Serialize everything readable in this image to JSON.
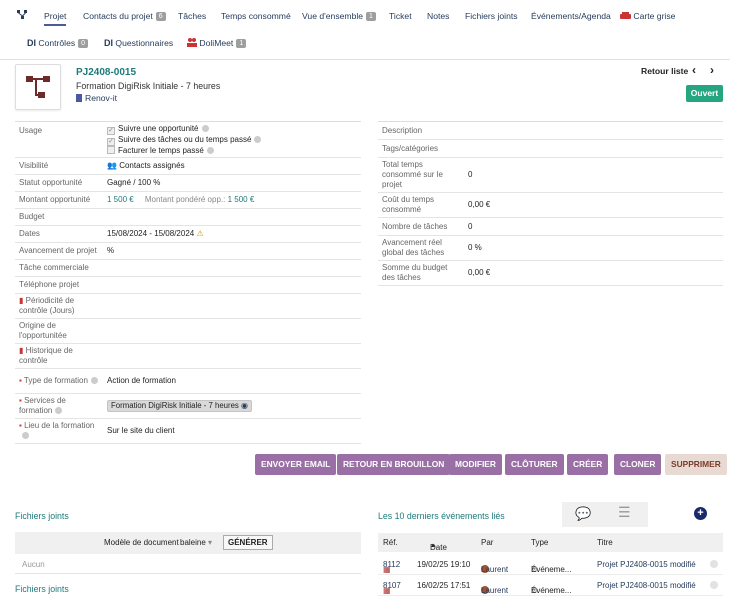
{
  "tabs": [
    {
      "label": "Projet"
    },
    {
      "label": "Contacts du projet",
      "badge": "6"
    },
    {
      "label": "Tâches"
    },
    {
      "label": "Temps consommé"
    },
    {
      "label": "Vue d'ensemble",
      "badge": "1"
    },
    {
      "label": "Ticket"
    },
    {
      "label": "Notes"
    },
    {
      "label": "Fichiers joints"
    },
    {
      "label": "Événements/Agenda"
    },
    {
      "label": "Carte grise"
    }
  ],
  "tabs2": [
    {
      "label": "Contrôles",
      "badge": "0",
      "prefix": "DI"
    },
    {
      "label": "Questionnaires",
      "prefix": "DI"
    },
    {
      "label": "DoliMeet",
      "badge": "1"
    }
  ],
  "header": {
    "ref": "PJ2408-0015",
    "title": "Formation DigiRisk Initiale - 7 heures",
    "thirdparty": "Renov-it",
    "back_link": "Retour liste",
    "status": "Ouvert"
  },
  "left_fields": {
    "usage_label": "Usage",
    "usage_opt1": "Suivre une opportunité",
    "usage_opt2": "Suivre des tâches ou du temps passé",
    "usage_opt3": "Facturer le temps passé",
    "visibilite_label": "Visibilité",
    "visibilite_value": "Contacts assignés",
    "statut_label": "Statut opportunité",
    "statut_value": "Gagné / 100 %",
    "montant_label": "Montant opportunité",
    "montant_value": "1 500 €",
    "montant_pondere_label": "Montant pondéré opp.:",
    "montant_pondere_value": "1 500 €",
    "budget_label": "Budget",
    "dates_label": "Dates",
    "dates_start": "15/08/2024",
    "dates_sep": "-",
    "dates_end": "15/08/2024",
    "avancement_label": "Avancement de projet",
    "avancement_value": "%",
    "tache_label": "Tâche commerciale",
    "telephone_label": "Téléphone projet",
    "periodicite_label": "Périodicité de contrôle (Jours)",
    "origine_label": "Origine de l'opportunitée",
    "historique_label": "Historique de contrôle",
    "type_formation_label": "Type de formation",
    "type_formation_value": "Action de formation",
    "services_label": "Services de formation",
    "services_value": "Formation DigiRisk Initiale - 7 heures",
    "lieu_label": "Lieu de la formation",
    "lieu_value": "Sur le site du client"
  },
  "right_fields": {
    "description_label": "Description",
    "tags_label": "Tags/catégories",
    "total_temps_label": "Total temps consommé sur le projet",
    "total_temps_value": "0",
    "cout_temps_label": "Coût du temps consommé",
    "cout_temps_value": "0,00 €",
    "nb_taches_label": "Nombre de tâches",
    "nb_taches_value": "0",
    "avancement_reel_label": "Avancement réel global des tâches",
    "avancement_reel_value": "0 %",
    "somme_budget_label": "Somme du budget des tâches",
    "somme_budget_value": "0,00 €"
  },
  "actions": {
    "envoyer": "ENVOYER EMAIL",
    "brouillon": "RETOUR EN BROUILLON",
    "modifier": "MODIFIER",
    "cloturer": "CLÔTURER",
    "creer": "CRÉER",
    "cloner": "CLONER",
    "supprimer": "SUPPRIMER"
  },
  "files": {
    "title": "Fichiers joints",
    "model_label": "Modèle de document",
    "model_value": "baleine",
    "generate": "GÉNÉRER",
    "empty": "Aucun",
    "title2": "Fichiers joints"
  },
  "events": {
    "title": "Les 10 derniers événements liés",
    "col_ref": "Réf.",
    "col_date": "Date",
    "col_par": "Par",
    "col_type": "Type",
    "col_titre": "Titre",
    "rows": [
      {
        "ref": "8112",
        "date": "19/02/25 19:10",
        "par": "Laurent",
        "type": "Événeme...",
        "titre": "Projet PJ2408-0015 modifié"
      },
      {
        "ref": "8107",
        "date": "16/02/25 17:51",
        "par": "Laurent",
        "type": "Événeme...",
        "titre": "Projet PJ2408-0015 modifié"
      }
    ]
  },
  "colors": {
    "accent": "#9a6fa5",
    "status": "#25a580",
    "link": "#263c5c",
    "teal": "#1f7a7a"
  }
}
